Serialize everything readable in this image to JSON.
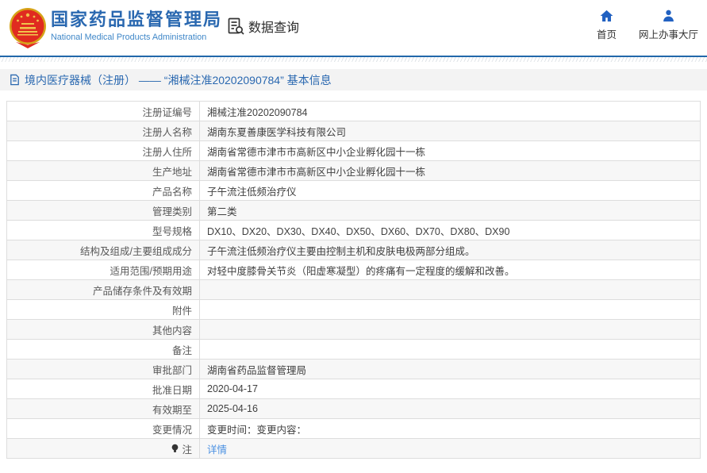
{
  "header": {
    "org_name_cn": "国家药品监督管理局",
    "org_name_en": "National Medical Products Administration",
    "data_query_label": "数据查询",
    "nav_home_label": "首页",
    "nav_hall_label": "网上办事大厅"
  },
  "breadcrumb": {
    "text": "境内医疗器械（注册） —— “湘械注准20202090784” 基本信息"
  },
  "table": {
    "rows": [
      {
        "label": "注册证编号",
        "value": "湘械注准20202090784"
      },
      {
        "label": "注册人名称",
        "value": "湖南东夏善康医学科技有限公司"
      },
      {
        "label": "注册人住所",
        "value": "湖南省常德市津市市高新区中小企业孵化园十一栋"
      },
      {
        "label": "生产地址",
        "value": "湖南省常德市津市市高新区中小企业孵化园十一栋"
      },
      {
        "label": "产品名称",
        "value": "子午流注低频治疗仪"
      },
      {
        "label": "管理类别",
        "value": "第二类"
      },
      {
        "label": "型号规格",
        "value": "DX10、DX20、DX30、DX40、DX50、DX60、DX70、DX80、DX90"
      },
      {
        "label": "结构及组成/主要组成成分",
        "value": "子午流注低频治疗仪主要由控制主机和皮肤电极两部分组成。"
      },
      {
        "label": "适用范围/预期用途",
        "value": "对轻中度膝骨关节炎（阳虚寒凝型）的疼痛有一定程度的缓解和改善。"
      },
      {
        "label": "产品储存条件及有效期",
        "value": ""
      },
      {
        "label": "附件",
        "value": ""
      },
      {
        "label": "其他内容",
        "value": ""
      },
      {
        "label": "备注",
        "value": ""
      },
      {
        "label": "审批部门",
        "value": "湖南省药品监督管理局"
      },
      {
        "label": "批准日期",
        "value": "2020-04-17"
      },
      {
        "label": "有效期至",
        "value": "2025-04-16"
      },
      {
        "label": "变更情况",
        "value": "变更时间：变更内容："
      },
      {
        "label": "注",
        "label_icon": "bulb-icon",
        "value": "详情",
        "value_type": "link"
      }
    ]
  },
  "colors": {
    "brand_blue": "#2a68b0",
    "divider_blue": "#2268aa",
    "link_blue": "#4a90e2",
    "nav_icon_blue": "#2161c1",
    "emblem_red": "#e02b20",
    "emblem_gold": "#f0c24b",
    "row_alt_bg": "#f7f7f7",
    "border_gray": "#dddddd"
  }
}
